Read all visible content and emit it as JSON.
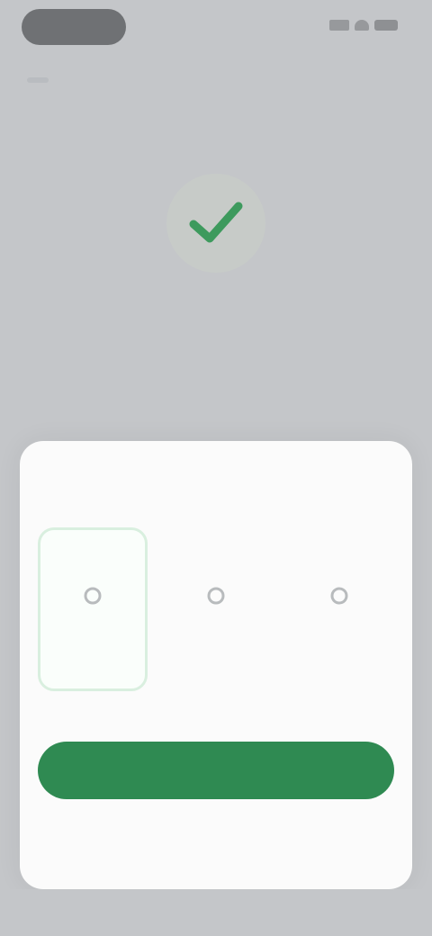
{
  "status_bar": {
    "icons": [
      "cellular-signal-icon",
      "wifi-icon",
      "battery-icon"
    ]
  },
  "confirmation": {
    "icon": "checkmark-icon",
    "message": ""
  },
  "sheet": {
    "title": "",
    "options": [
      {
        "icon": "option-icon",
        "label": "",
        "selected": true
      },
      {
        "icon": "option-icon",
        "label": "",
        "selected": false
      },
      {
        "icon": "option-icon",
        "label": "",
        "selected": false
      }
    ],
    "primary_button": "",
    "secondary_link": ""
  },
  "colors": {
    "accent": "#2f8a52",
    "check": "#3d9a5d",
    "selected_border": "#d9efdf",
    "backdrop": "#c4c6c9",
    "sheet": "#fbfbfb"
  }
}
